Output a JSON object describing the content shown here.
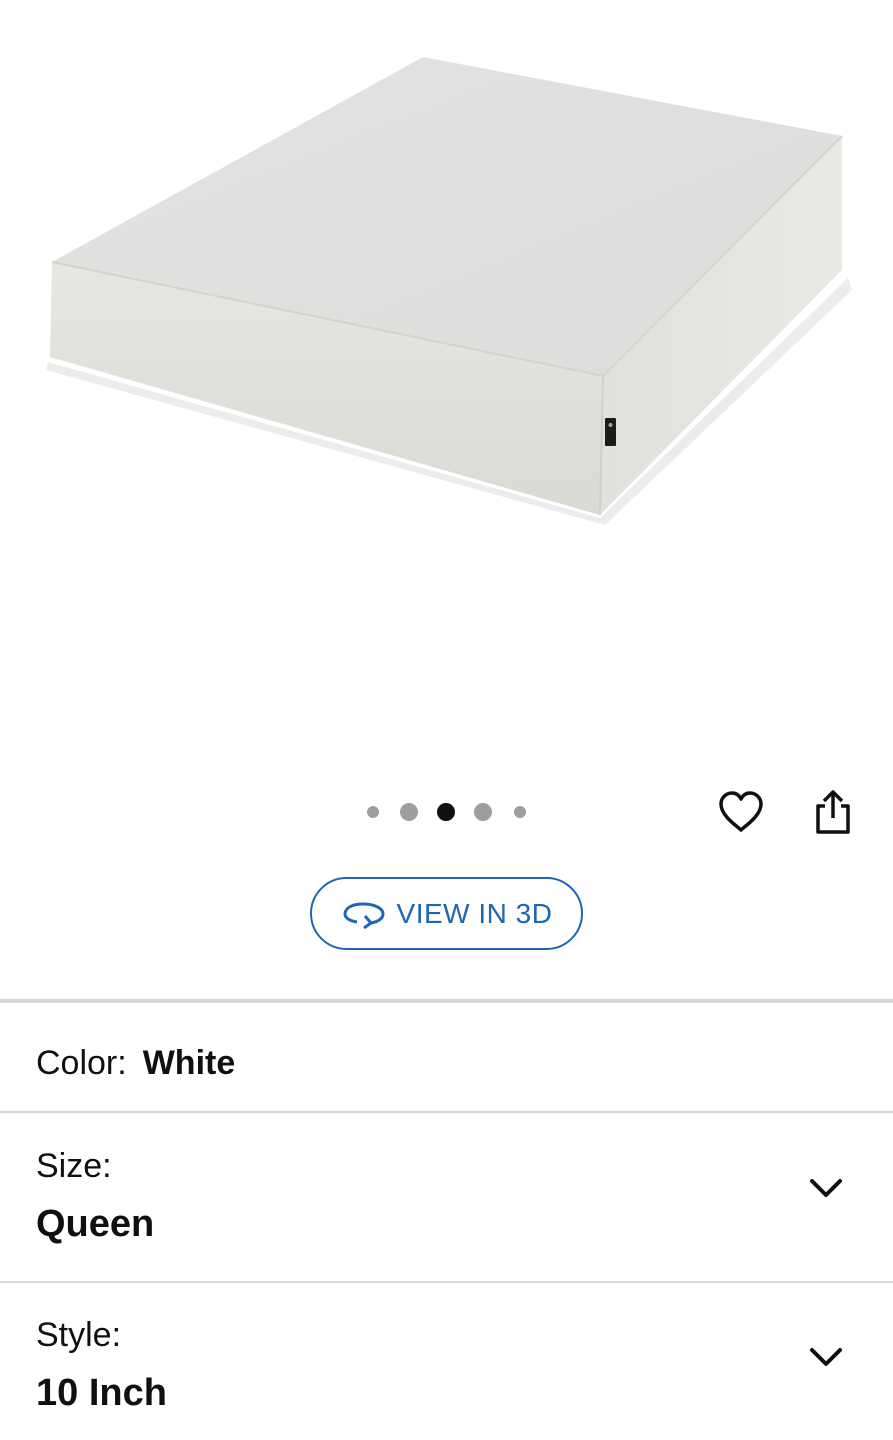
{
  "product": {
    "image_name": "white-memory-foam-mattress",
    "carousel": {
      "count": 5,
      "active_index": 2
    }
  },
  "actions": {
    "wishlist_icon": "heart-outline-icon",
    "share_icon": "share-icon"
  },
  "view3d": {
    "label": "VIEW IN 3D",
    "icon": "rotate-3d-icon",
    "color": "#1f66b3"
  },
  "options": {
    "color": {
      "label": "Color:",
      "value": "White"
    },
    "size": {
      "label": "Size:",
      "value": "Queen"
    },
    "style": {
      "label": "Style:",
      "value": "10 Inch"
    }
  },
  "colors": {
    "text": "#0f1111",
    "divider": "#d5d9d9",
    "dot_inactive": "#9e9e9e",
    "dot_active": "#0f1111"
  }
}
